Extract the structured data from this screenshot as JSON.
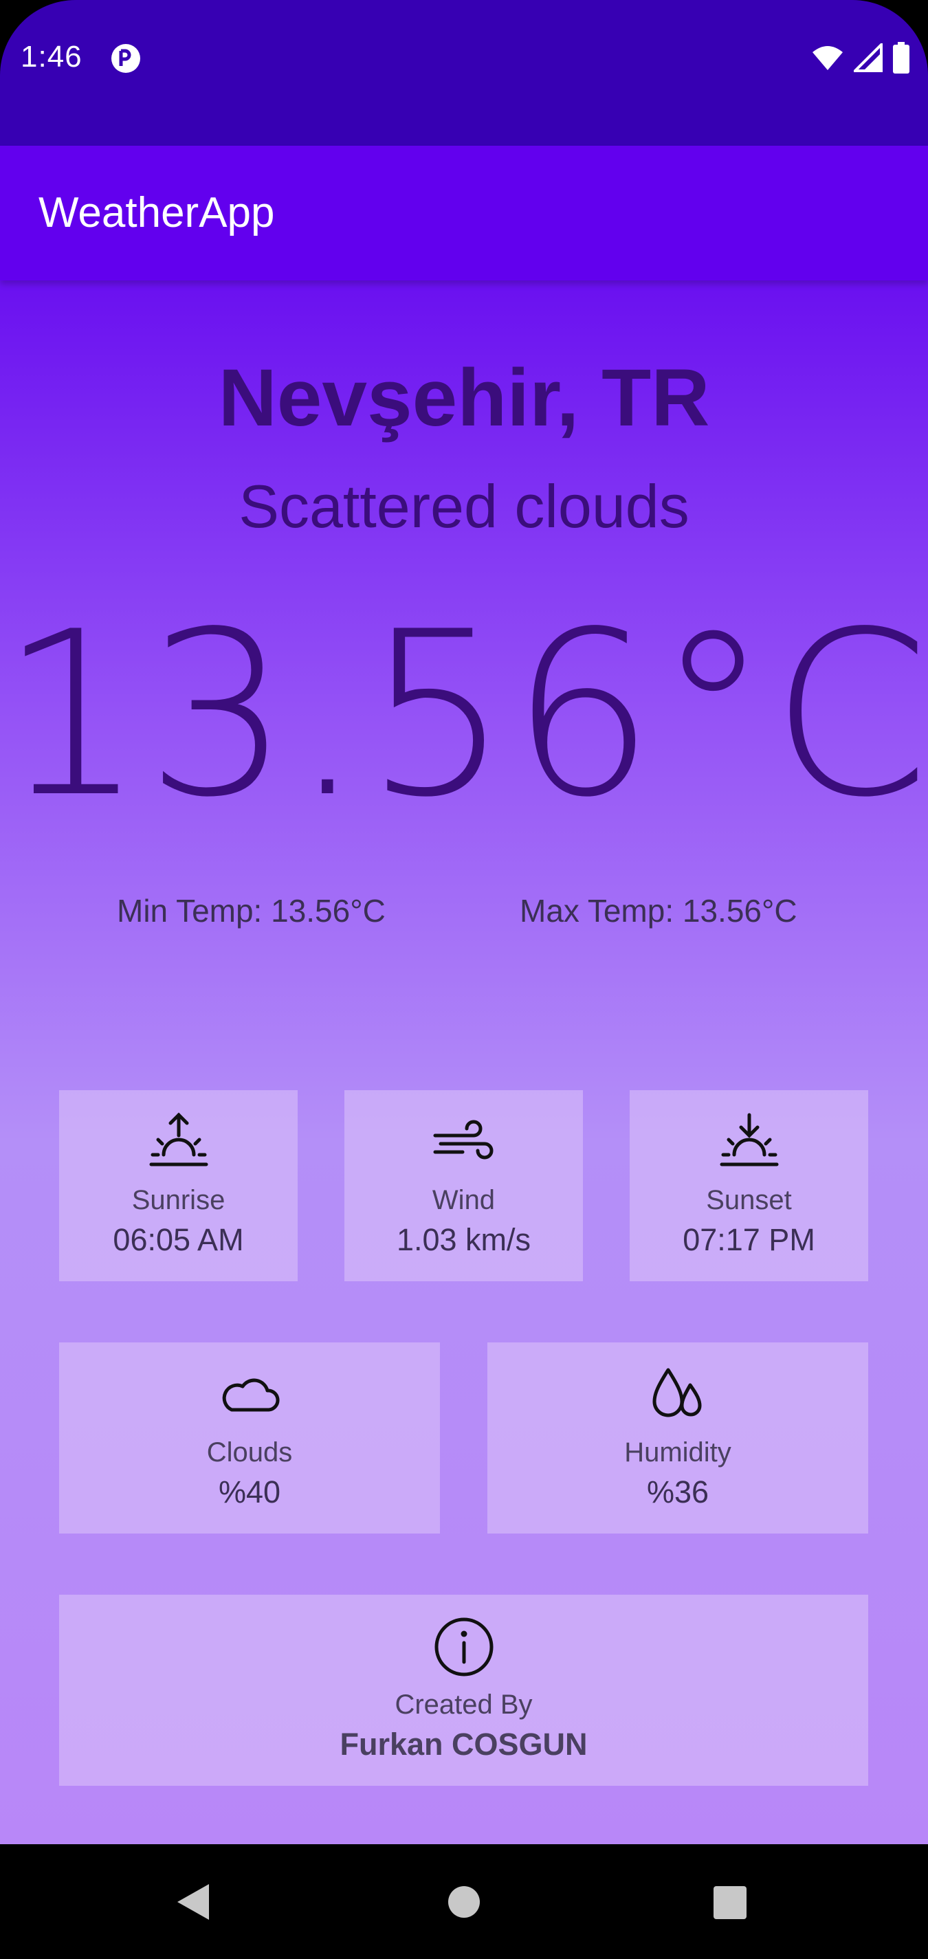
{
  "status_bar": {
    "time": "1:46"
  },
  "app_bar": {
    "title": "WeatherApp"
  },
  "weather": {
    "city": "Nevşehir, TR",
    "description": "Scattered clouds",
    "temperature": "13.56°C",
    "min_temp": "Min Temp: 13.56°C",
    "max_temp": "Max Temp: 13.56°C"
  },
  "cards": {
    "sunrise": {
      "label": "Sunrise",
      "value": "06:05 AM",
      "icon": "sunrise-icon"
    },
    "wind": {
      "label": "Wind",
      "value": "1.03 km/s",
      "icon": "wind-icon"
    },
    "sunset": {
      "label": "Sunset",
      "value": "07:17 PM",
      "icon": "sunset-icon"
    },
    "clouds": {
      "label": "Clouds",
      "value": "%40",
      "icon": "cloud-icon"
    },
    "humidity": {
      "label": "Humidity",
      "value": "%36",
      "icon": "humidity-icon"
    },
    "credits": {
      "label": "Created By",
      "value": "Furkan COSGUN",
      "icon": "info-icon"
    }
  },
  "colors": {
    "status_bar": "#3700b3",
    "app_bar": "#6200ee",
    "text_dark": "#3b0d7c"
  }
}
